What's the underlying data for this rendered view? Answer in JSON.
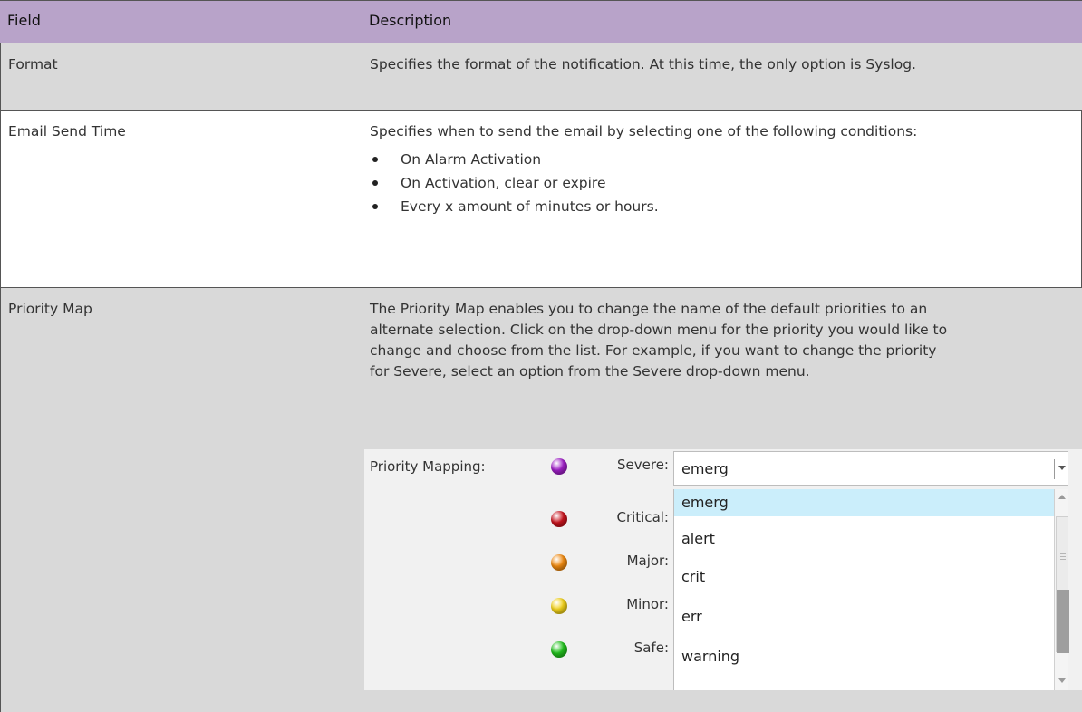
{
  "table": {
    "headers": [
      "Field",
      "Description"
    ],
    "rows": [
      {
        "field": "Format",
        "description": "Specifies the format of the notification. At this time, the only option is Syslog."
      },
      {
        "field": "Email Send Time",
        "description": "Specifies when to send the email by selecting one of the following conditions:",
        "bullets": [
          "On Alarm Activation",
          "On Activation, clear or expire",
          "Every x amount of minutes or hours."
        ]
      },
      {
        "field": "Priority Map",
        "description": "The Priority Map enables you to change the name of the default priorities to an alternate selection. Click on the drop-down menu for the priority you would like to change and choose from the list. For example, if you want to change the priority for Severe, select an option from the Severe drop-down menu."
      }
    ]
  },
  "priority_widget": {
    "title": "Priority Mapping:",
    "priorities": [
      {
        "label": "Severe:",
        "color": "#a020c8"
      },
      {
        "label": "Critical:",
        "color": "#c8141e"
      },
      {
        "label": "Major:",
        "color": "#f08a10"
      },
      {
        "label": "Minor:",
        "color": "#f2d21a"
      },
      {
        "label": "Safe:",
        "color": "#22c21e"
      }
    ],
    "combo_value": "emerg",
    "options": [
      "emerg",
      "alert",
      "crit",
      "err",
      "warning"
    ],
    "selected_option": "emerg",
    "colors": {
      "header_bg": "#b8a3c9",
      "row_alt_bg": "#d9d9d9",
      "selected_bg": "#cbeefb"
    }
  }
}
